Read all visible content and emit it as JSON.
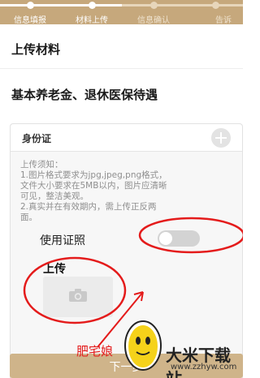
{
  "stepper": {
    "steps": [
      {
        "label": "信息填报",
        "state": "done"
      },
      {
        "label": "材料上传",
        "state": "current"
      },
      {
        "label": "信息确认",
        "state": "pending"
      },
      {
        "label": "告诉",
        "state": "pending"
      }
    ]
  },
  "section": {
    "title": "上传材料",
    "service_name": "基本养老金、退休医保待遇"
  },
  "card": {
    "title": "身份证",
    "notice_lines": [
      "上传须知：",
      "1.图片格式要求为jpg,jpeg,png格式，",
      "文件大小要求在5MB以内，图片应清晰",
      "可见，整洁美观。",
      "2.真实并在有效期内，需上传正反两",
      "面。"
    ],
    "use_cert_label": "使用证照",
    "use_cert_enabled": false,
    "upload_label": "上传"
  },
  "bottom_button": {
    "label": "下一步"
  },
  "watermark": {
    "caption": "肥宅娘",
    "site_name": "大米下载站",
    "site_url": "www.zzhyw.com"
  },
  "colors": {
    "accent": "#c6a87c",
    "annotation": "#e41b1b"
  },
  "icons": [
    "plus-circle-icon",
    "camera-icon"
  ]
}
